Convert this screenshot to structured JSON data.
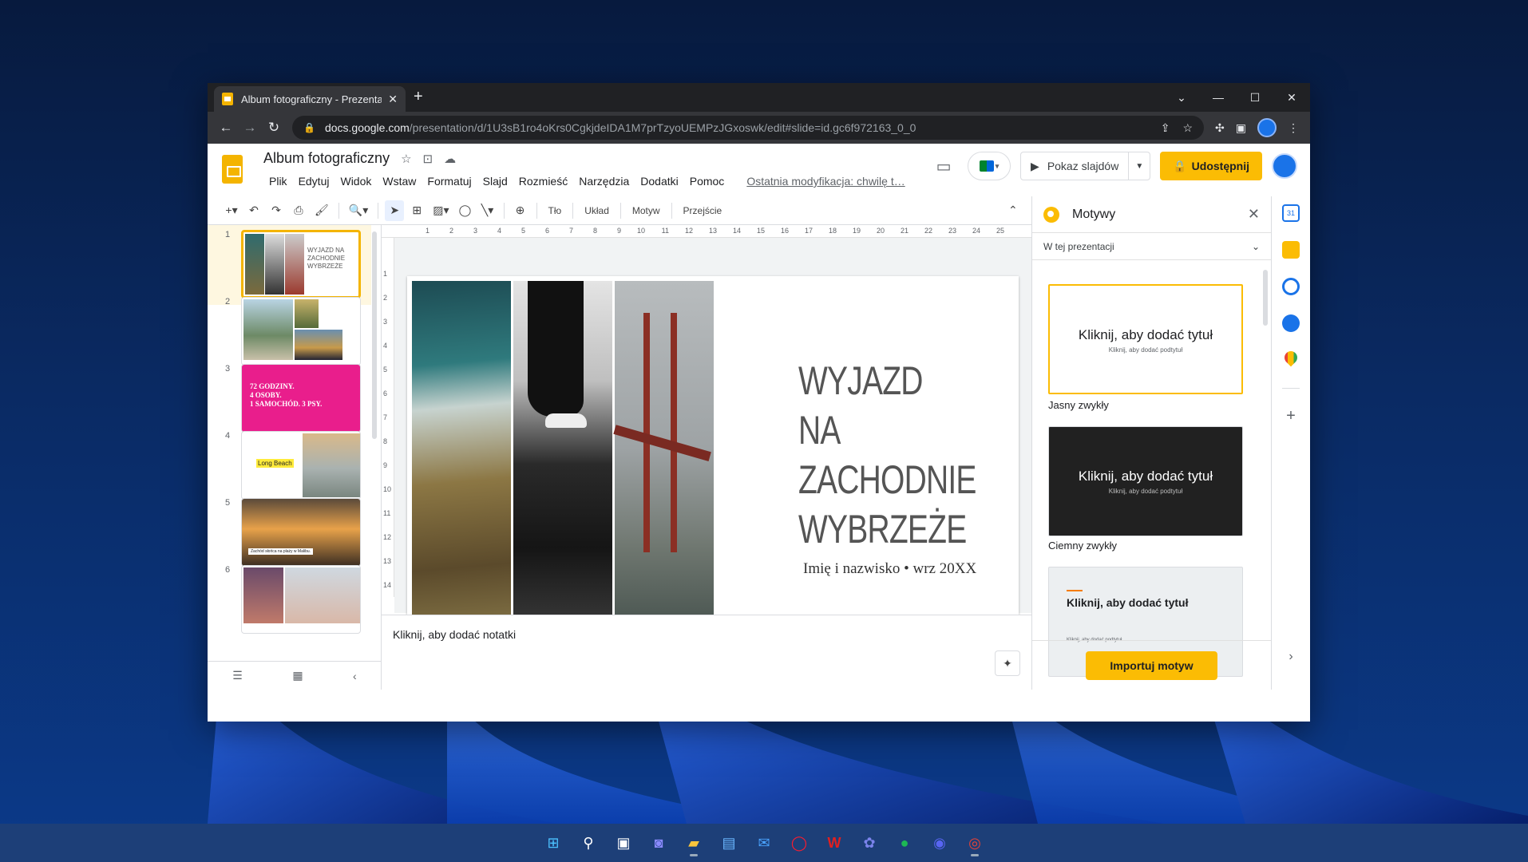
{
  "browser": {
    "tab_title": "Album fotograficzny - Prezentacje",
    "url_host": "docs.google.com",
    "url_path": "/presentation/d/1U3sB1ro4oKrs0CgkjdeIDA1M7prTzyoUEMPzJGxoswk/edit#slide=id.gc6f972163_0_0"
  },
  "doc": {
    "title": "Album fotograficzny",
    "menus": [
      "Plik",
      "Edytuj",
      "Widok",
      "Wstaw",
      "Formatuj",
      "Slajd",
      "Rozmieść",
      "Narzędzia",
      "Dodatki",
      "Pomoc"
    ],
    "last_modified": "Ostatnia modyfikacja: chwilę t…",
    "present_label": "Pokaz slajdów",
    "share_label": "Udostępnij"
  },
  "toolbar": {
    "background": "Tło",
    "layout": "Układ",
    "theme": "Motyw",
    "transition": "Przejście"
  },
  "ruler": {
    "h_ticks": [
      "1",
      "2",
      "3",
      "4",
      "5",
      "6",
      "7",
      "8",
      "9",
      "10",
      "11",
      "12",
      "13",
      "14",
      "15",
      "16",
      "17",
      "18",
      "19",
      "20",
      "21",
      "22",
      "23",
      "24",
      "25"
    ],
    "v_ticks": [
      "1",
      "2",
      "3",
      "4",
      "5",
      "6",
      "7",
      "8",
      "9",
      "10",
      "11",
      "12",
      "13",
      "14"
    ]
  },
  "filmstrip": {
    "numbers": [
      "1",
      "2",
      "3",
      "4",
      "5",
      "6"
    ],
    "slide1_thumb_title": "WYJAZD NA ZACHODNIE WYBRZEŻE",
    "slide3_text": "72 GODZINY.\n4 OSOBY.\n1 SAMOCHÓD. 3 PSY.",
    "slide4_text": "Long Beach",
    "slide5_text": "Zachód słońca na plaży w Malibu."
  },
  "slide": {
    "title": "WYJAZD\nNA\nZACHODNIE\nWYBRZEŻE",
    "subtitle": "Imię i nazwisko • wrz 20XX"
  },
  "notes": {
    "placeholder": "Kliknij, aby dodać notatki"
  },
  "themes": {
    "header": "Motywy",
    "filter": "W tej prezentacji",
    "cards": [
      {
        "title": "Kliknij, aby dodać tytuł",
        "subtitle": "Kliknij, aby dodać podtytuł",
        "name": "Jasny zwykły"
      },
      {
        "title": "Kliknij, aby dodać tytuł",
        "subtitle": "Kliknij, aby dodać podtytuł",
        "name": "Ciemny zwykły"
      },
      {
        "title": "Kliknij, aby dodać tytuł",
        "subtitle": "Kliknij, aby dodać podtytuł",
        "name": ""
      }
    ],
    "import_label": "Importuj motyw"
  },
  "colors": {
    "accent": "#fbbc04",
    "slides_yellow": "#f4b400",
    "pink_slide": "#e91e8c"
  }
}
